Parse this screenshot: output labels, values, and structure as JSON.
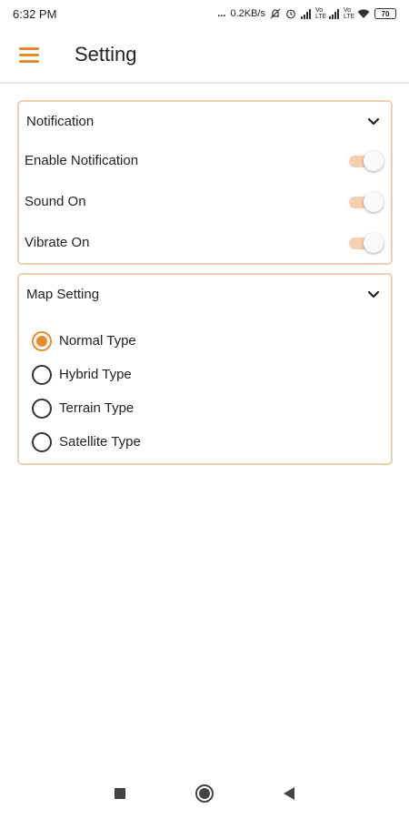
{
  "status_bar": {
    "time": "6:32 PM",
    "dots": "...",
    "net_speed": "0.2KB/s",
    "sim1": "Vo\nLTE",
    "sim2": "Vo\nLTE",
    "battery": "70"
  },
  "app_bar": {
    "title": "Setting"
  },
  "notification_card": {
    "title": "Notification",
    "toggles": [
      {
        "label": "Enable Notification",
        "on": true
      },
      {
        "label": "Sound On",
        "on": true
      },
      {
        "label": "Vibrate On",
        "on": true
      }
    ]
  },
  "map_card": {
    "title": "Map Setting",
    "options": [
      {
        "label": "Normal Type",
        "selected": true
      },
      {
        "label": "Hybrid Type",
        "selected": false
      },
      {
        "label": "Terrain Type",
        "selected": false
      },
      {
        "label": "Satellite Type",
        "selected": false
      }
    ]
  },
  "colors": {
    "accent": "#e88a2a",
    "card_border": "#efd0ad",
    "toggle_track": "#f6cfae"
  },
  "icons": {
    "menu": "hamburger-menu-icon",
    "chevron": "chevron-down-icon",
    "nav_recents": "square-recents-icon",
    "nav_home": "circle-home-icon",
    "nav_back": "triangle-back-icon"
  }
}
